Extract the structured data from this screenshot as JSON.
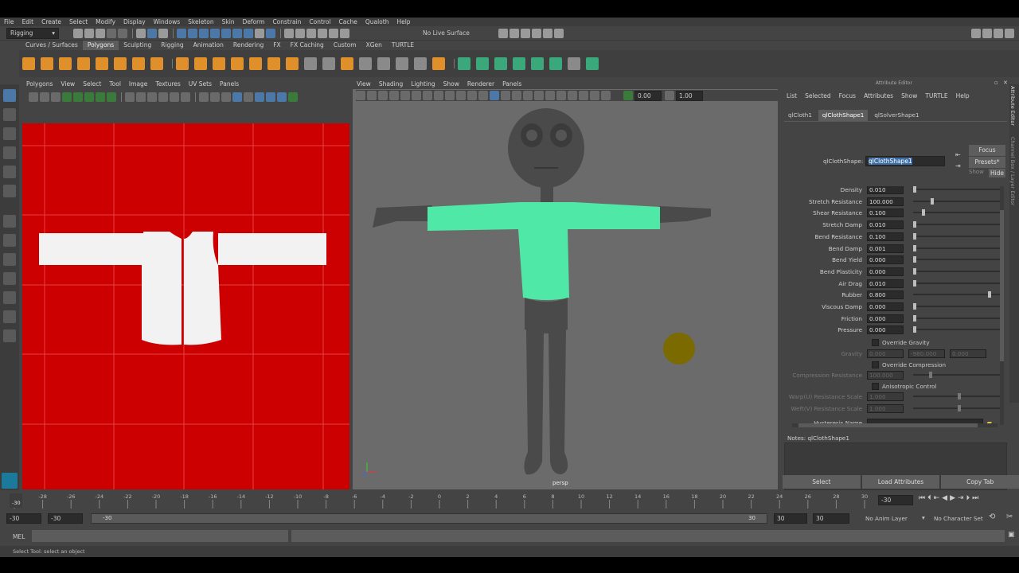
{
  "menu": [
    "File",
    "Edit",
    "Create",
    "Select",
    "Modify",
    "Display",
    "Windows",
    "Skeleton",
    "Skin",
    "Deform",
    "Constrain",
    "Control",
    "Cache",
    "Qualoth",
    "Help"
  ],
  "status_line": {
    "mode": "Rigging",
    "live_surface": "No Live Surface",
    "value_a": "0.00",
    "value_b": "1.00"
  },
  "shelf_tabs": [
    "Curves / Surfaces",
    "Polygons",
    "Sculpting",
    "Rigging",
    "Animation",
    "Rendering",
    "FX",
    "FX Caching",
    "Custom",
    "XGen",
    "TURTLE"
  ],
  "shelf_active": "Polygons",
  "uv_editor": {
    "menu": [
      "Polygons",
      "View",
      "Select",
      "Tool",
      "Image",
      "Textures",
      "UV Sets",
      "Panels"
    ]
  },
  "viewport": {
    "menu": [
      "View",
      "Shading",
      "Lighting",
      "Show",
      "Renderer",
      "Panels"
    ],
    "camera": "persp",
    "near": "0.00",
    "far": "1.00"
  },
  "attribute_editor": {
    "title": "Attribute Editor",
    "menu": [
      "List",
      "Selected",
      "Focus",
      "Attributes",
      "Show",
      "TURTLE",
      "Help"
    ],
    "tabs": [
      "qlCloth1",
      "qlClothShape1",
      "qlSolverShape1"
    ],
    "active_tab": "qlClothShape1",
    "shape_label": "qlClothShape:",
    "shape_value": "qlClothShape1",
    "focus_label": "Focus",
    "presets_label": "Presets*",
    "show_label": "Show",
    "hide_label": "Hide",
    "attributes": [
      {
        "label": "Density",
        "value": "0.010",
        "slider": 0.0
      },
      {
        "label": "Stretch Resistance",
        "value": "100.000",
        "slider": 0.2
      },
      {
        "label": "Shear Resistance",
        "value": "0.100",
        "slider": 0.1
      },
      {
        "label": "Stretch Damp",
        "value": "0.010",
        "slider": 0.0
      },
      {
        "label": "Bend Resistance",
        "value": "0.100",
        "slider": 0.0
      },
      {
        "label": "Bend Damp",
        "value": "0.001",
        "slider": 0.0
      },
      {
        "label": "Bend Yield",
        "value": "0.000",
        "slider": 0.0
      },
      {
        "label": "Bend Plasticity",
        "value": "0.000",
        "slider": 0.0
      },
      {
        "label": "Air Drag",
        "value": "0.010",
        "slider": 0.0
      },
      {
        "label": "Rubber",
        "value": "0.800",
        "slider": 0.87
      },
      {
        "label": "Viscous Damp",
        "value": "0.000",
        "slider": 0.0
      },
      {
        "label": "Friction",
        "value": "0.000",
        "slider": 0.0
      },
      {
        "label": "Pressure",
        "value": "0.000",
        "slider": 0.0
      }
    ],
    "override_gravity": "Override Gravity",
    "gravity_label": "Gravity",
    "gravity_values": [
      "0.000",
      "-980.000",
      "0.000"
    ],
    "override_compression": "Override Compression",
    "compression_label": "Compression Resistance",
    "compression_value": "100.000",
    "anisotropic": "Anisotropic Control",
    "warp_label": "Warp(U) Resistance Scale",
    "warp_value": "1.000",
    "weft_label": "Weft(V) Resistance Scale",
    "weft_value": "1.000",
    "hysteresis_label": "Hysteresis Name",
    "notes_label": "Notes:",
    "notes_value": "qlClothShape1",
    "buttons": [
      "Select",
      "Load Attributes",
      "Copy Tab"
    ]
  },
  "side_tabs": [
    "Attribute Editor",
    "Channel Box / Layer Editor"
  ],
  "timeline": {
    "ticks": [
      "-30",
      "-28",
      "-26",
      "-24",
      "-22",
      "-20",
      "-18",
      "-16",
      "-14",
      "-12",
      "-10",
      "-8",
      "-6",
      "-4",
      "-2",
      "0",
      "2",
      "4",
      "6",
      "8",
      "10",
      "12",
      "14",
      "16",
      "18",
      "20",
      "22",
      "24",
      "26",
      "28",
      "30"
    ],
    "current": "-30",
    "current_field": "-30"
  },
  "range": {
    "start": "-30",
    "inner_start": "-30",
    "slider_start": "-30",
    "slider_end": "30",
    "inner_end": "30",
    "end": "30",
    "anim_layer": "No Anim Layer",
    "char_set": "No Character Set"
  },
  "command_line": {
    "lang": "MEL"
  },
  "help_line": "Select Tool: select an object"
}
